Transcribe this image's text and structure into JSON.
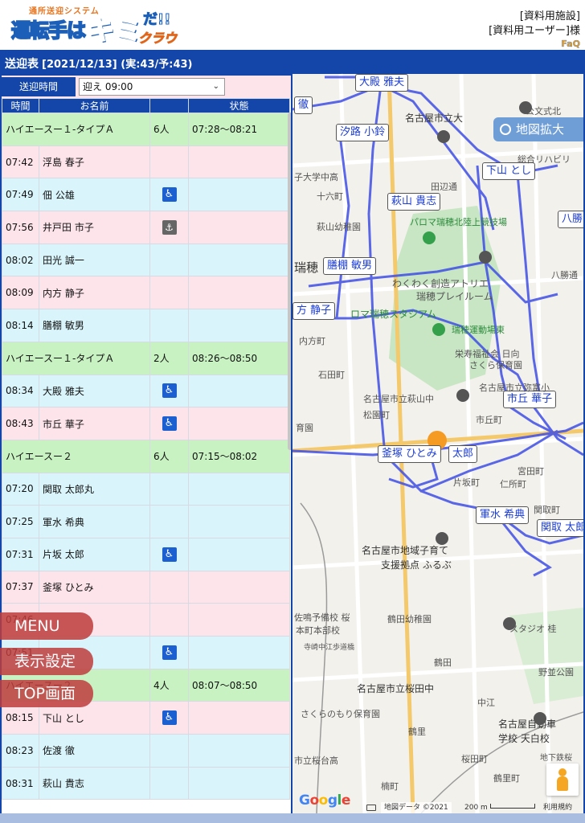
{
  "header": {
    "logo_sub": "通所送迎システム",
    "logo_main": "運転手は",
    "logo_kimi": "キミ",
    "logo_da": "だ!!",
    "logo_cloud": "クラウド",
    "facility": "[資料用施設]",
    "user": "[資料用ユーザー]様",
    "faq": "FaQ"
  },
  "panel": {
    "title": "送迎表",
    "date_info": "[2021/12/13] (実:43/予:43)",
    "time_label": "送迎時間",
    "time_value": "迎え 09:00",
    "columns": [
      "時間",
      "お名前",
      "",
      "状態"
    ]
  },
  "rows": [
    {
      "kind": "grp",
      "time": "ハイエースー１-タイプＡ",
      "name": "",
      "count": "6人",
      "status": "07:28〜08:21"
    },
    {
      "kind": "pink",
      "time": "07:42",
      "name": "浮島 春子",
      "icon": "",
      "status": ""
    },
    {
      "kind": "cyan",
      "time": "07:49",
      "name": "佃 公雄",
      "icon": "wc",
      "status": ""
    },
    {
      "kind": "pink",
      "time": "07:56",
      "name": "井戸田 市子",
      "icon": "walk",
      "status": ""
    },
    {
      "kind": "cyan",
      "time": "08:02",
      "name": "田光 誠一",
      "icon": "",
      "status": ""
    },
    {
      "kind": "pink",
      "time": "08:09",
      "name": "内方 静子",
      "icon": "",
      "status": ""
    },
    {
      "kind": "cyan",
      "time": "08:14",
      "name": "膳棚 敏男",
      "icon": "",
      "status": ""
    },
    {
      "kind": "grp",
      "time": "ハイエースー１-タイプＡ",
      "name": "",
      "count": "2人",
      "status": "08:26〜08:50"
    },
    {
      "kind": "cyan",
      "time": "08:34",
      "name": "大殿 雅夫",
      "icon": "wc",
      "status": ""
    },
    {
      "kind": "pink",
      "time": "08:43",
      "name": "市丘 華子",
      "icon": "wc",
      "status": ""
    },
    {
      "kind": "grp",
      "time": "ハイエースー２",
      "name": "",
      "count": "6人",
      "status": "07:15〜08:02"
    },
    {
      "kind": "cyan",
      "time": "07:20",
      "name": "関取 太郎丸",
      "icon": "",
      "status": ""
    },
    {
      "kind": "cyan",
      "time": "07:25",
      "name": "軍水 希典",
      "icon": "",
      "status": ""
    },
    {
      "kind": "cyan",
      "time": "07:31",
      "name": "片坂 太郎",
      "icon": "wc",
      "status": ""
    },
    {
      "kind": "pink",
      "time": "07:37",
      "name": "釜塚 ひとみ",
      "icon": "",
      "status": ""
    },
    {
      "kind": "pink",
      "time": "07:46",
      "name": "",
      "icon": "",
      "status": ""
    },
    {
      "kind": "cyan",
      "time": "07:51",
      "name": "",
      "icon": "wc",
      "status": ""
    },
    {
      "kind": "grp",
      "time": "ハイエースー２",
      "name": "",
      "count": "4人",
      "status": "08:07〜08:50"
    },
    {
      "kind": "pink",
      "time": "08:15",
      "name": "下山 とし",
      "icon": "wc",
      "status": ""
    },
    {
      "kind": "cyan",
      "time": "08:23",
      "name": "佐渡 徹",
      "icon": "",
      "status": ""
    },
    {
      "kind": "cyan",
      "time": "08:31",
      "name": "萩山 貴志",
      "icon": "",
      "status": ""
    }
  ],
  "float_buttons": [
    "MENU",
    "表示設定",
    "TOP画面"
  ],
  "map": {
    "zoom_label": "地図拡大",
    "tags": [
      "大殿 雅夫",
      "徹",
      "汐路 小鈴",
      "下山 とし",
      "萩山 貴志",
      "八勝",
      "膳棚 敏男",
      "方 静子",
      "市丘 華子",
      "釜塚 ひとみ",
      "太郎",
      "軍水 希典",
      "関取 太郎"
    ],
    "labels": [
      "名古屋市立大",
      "公文式北",
      "総合リハビリ",
      "田辺通",
      "十六町",
      "萩山幼稚園",
      "パロマ瑞穂北陸上競技場",
      "瑞穂",
      "わくわく創造アトリエ",
      "瑞穂プレイルーム",
      "ロマ瑞穂スタジアム",
      "瑞穂運動場東",
      "八勝通",
      "内方町",
      "石田町",
      "栄寿福祉会 日向",
      "さくら保育園",
      "名古屋市立弥富小",
      "名古屋市立萩山中",
      "松園町",
      "育園",
      "市丘町",
      "片坂町",
      "仁所町",
      "宮田町",
      "関取町",
      "名古屋市地域子育て",
      "支援拠点 ふるぶ",
      "佐鳴予備校 桜",
      "本町本部校",
      "鶴田幼稚園",
      "スタジオ 桂",
      "寺崎中江歩道橋",
      "鶴田",
      "野並公園",
      "名古屋市立桜田中",
      "中江",
      "さくらのもり保育園",
      "鶴里",
      "名古屋自動車",
      "学校 天白校",
      "市立桜台高",
      "地下鉄桜",
      "鶴里町",
      "楠町",
      "子大学中高",
      "大学中高",
      "桜田町"
    ],
    "attribution": "地図データ ©2021",
    "scale": "200 m",
    "terms": "利用規約"
  }
}
